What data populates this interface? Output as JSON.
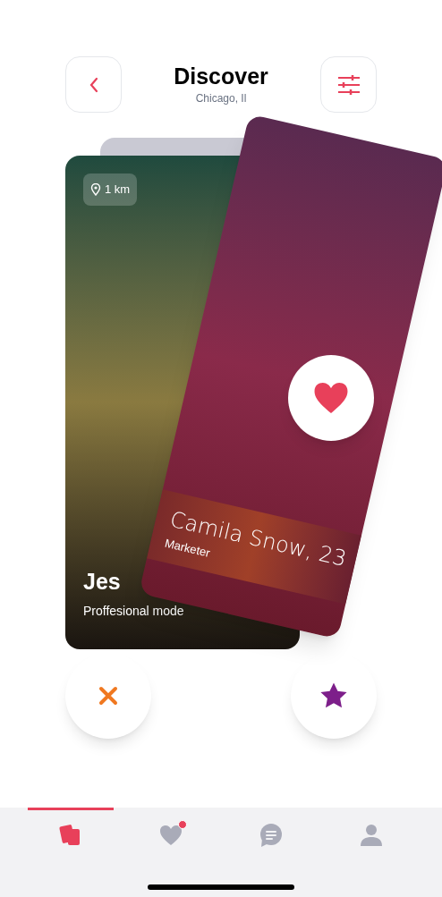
{
  "header": {
    "title": "Discover",
    "subtitle": "Chicago, Il"
  },
  "back_card": {
    "distance": "1 km",
    "name": "Jes",
    "occupation": "Proffesional mode"
  },
  "front_card": {
    "name": "Camila Snow, 23",
    "occupation": "Marketer"
  },
  "nav": [
    {
      "kind": "cards",
      "selected": true,
      "badge": false
    },
    {
      "kind": "matches",
      "selected": false,
      "badge": true
    },
    {
      "kind": "messages",
      "selected": false,
      "badge": false
    },
    {
      "kind": "profile",
      "selected": false,
      "badge": false
    }
  ]
}
